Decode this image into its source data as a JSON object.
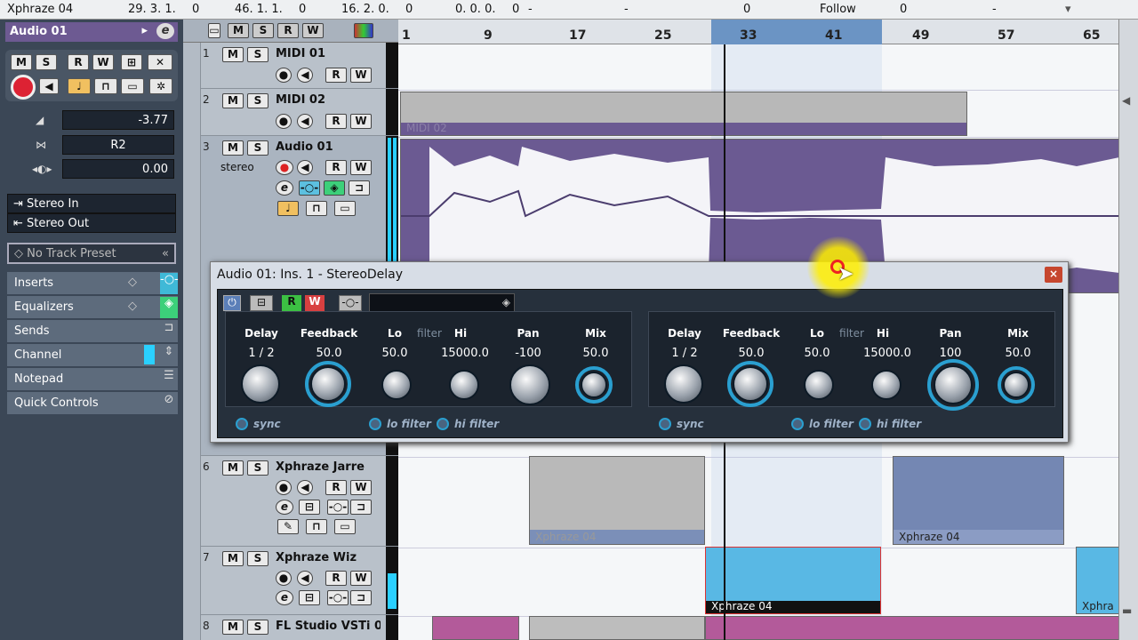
{
  "topbar": {
    "project": "Xphraze 04",
    "pos1": "29. 3. 1.",
    "pos1b": "0",
    "pos2": "46. 1. 1.",
    "pos2b": "0",
    "pos3": "16. 2. 0.",
    "pos3b": "0",
    "pos4": "0. 0. 0.",
    "pos4b": "0",
    "dash1": "-",
    "dash2": "-",
    "val1": "0",
    "follow": "Follow",
    "val2": "0",
    "dash3": "-"
  },
  "inspector": {
    "track": "Audio 01",
    "e": "e",
    "buttons": [
      "M",
      "S",
      "R",
      "W"
    ],
    "volume": "-3.77",
    "pan": "R2",
    "delay": "0.00",
    "input": "Stereo In",
    "output": "Stereo Out",
    "preset": "No Track Preset",
    "sections": [
      "Inserts",
      "Equalizers",
      "Sends",
      "Channel",
      "Notepad",
      "Quick Controls"
    ]
  },
  "tracks": [
    {
      "num": "1",
      "name": "MIDI 01"
    },
    {
      "num": "2",
      "name": "MIDI 02"
    },
    {
      "num": "3",
      "name": "Audio 01",
      "sub": "stereo"
    },
    {
      "num": "6",
      "name": "Xphraze Jarre"
    },
    {
      "num": "7",
      "name": "Xphraze Wiz"
    },
    {
      "num": "8",
      "name": "FL Studio VSTi 0"
    }
  ],
  "trackbtn": {
    "m": "M",
    "s": "S",
    "r": "R",
    "w": "W",
    "e": "e"
  },
  "ruler": [
    "1",
    "9",
    "17",
    "25",
    "33",
    "41",
    "49",
    "57",
    "65"
  ],
  "parts": {
    "midi02": "MIDI 02",
    "x1": "Xphraze 04",
    "x2": "Xphraze 04",
    "x3": "Xphraze 04",
    "x4": "Xphra"
  },
  "dialog": {
    "title": "Audio 01: Ins. 1 - StereoDelay",
    "close": "×",
    "left": {
      "labels": [
        "Delay",
        "Feedback",
        "Lo",
        "filter",
        "Hi",
        "Pan",
        "Mix"
      ],
      "values": [
        "1 / 2",
        "50.0",
        "50.0",
        "15000.0",
        "-100",
        "50.0"
      ],
      "sw": [
        "sync",
        "lo filter",
        "hi filter"
      ]
    },
    "right": {
      "labels": [
        "Delay",
        "Feedback",
        "Lo",
        "filter",
        "Hi",
        "Pan",
        "Mix"
      ],
      "values": [
        "1 / 2",
        "50.0",
        "50.0",
        "15000.0",
        "100",
        "50.0"
      ],
      "sw": [
        "sync",
        "lo filter",
        "hi filter"
      ]
    },
    "rw": [
      "R",
      "W"
    ]
  }
}
